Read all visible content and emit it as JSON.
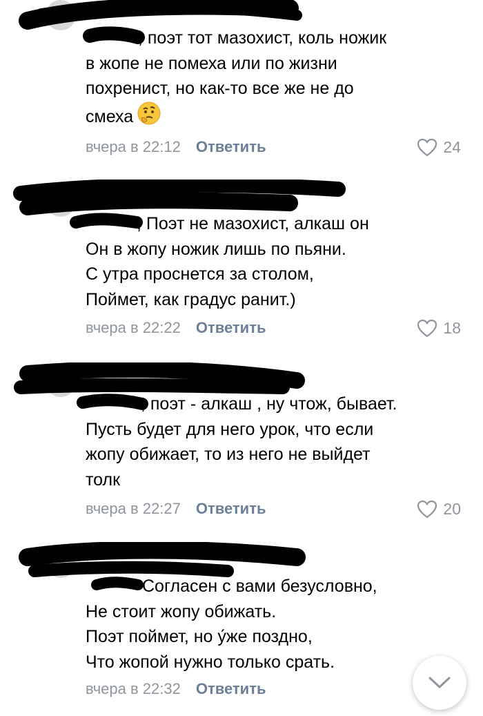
{
  "comments": [
    {
      "lines": [
        ", поэт тот мазохист, коль ножик",
        "в жопе не помеха или по жизни",
        "похренист, но как-то все же не до",
        "смеха"
      ],
      "emoji": "thinking-face",
      "time": "вчера в 22:12",
      "reply": "Ответить",
      "likes": "24"
    },
    {
      "lines": [
        ", Поэт не мазохист, алкаш он",
        "Он в жопу ножик лишь по пьяни.",
        "С утра проснется за столом,",
        "Поймет, как градус ранит.)"
      ],
      "time": "вчера в 22:22",
      "reply": "Ответить",
      "likes": "18"
    },
    {
      "lines": [
        ", поэт - алкаш , ну чтож, бывает.",
        "Пусть будет для него урок, что если",
        "жопу обижает,  то из него не выйдет",
        "толк"
      ],
      "time": "вчера в 22:27",
      "reply": "Ответить",
      "likes": "20"
    },
    {
      "lines": [
        "Согласен с вами безусловно,",
        "Не стоит жопу обижать.",
        "Поэт поймет, но у́же поздно,",
        "Что жопой нужно только срать."
      ],
      "time": "вчера в 22:32",
      "reply": "Ответить"
    }
  ],
  "icons": {
    "like": "heart-outline-icon",
    "scroll": "chevron-down-icon"
  },
  "colors": {
    "meta": "#8f959c",
    "reply": "#6b7f96",
    "redaction": "#000000"
  }
}
